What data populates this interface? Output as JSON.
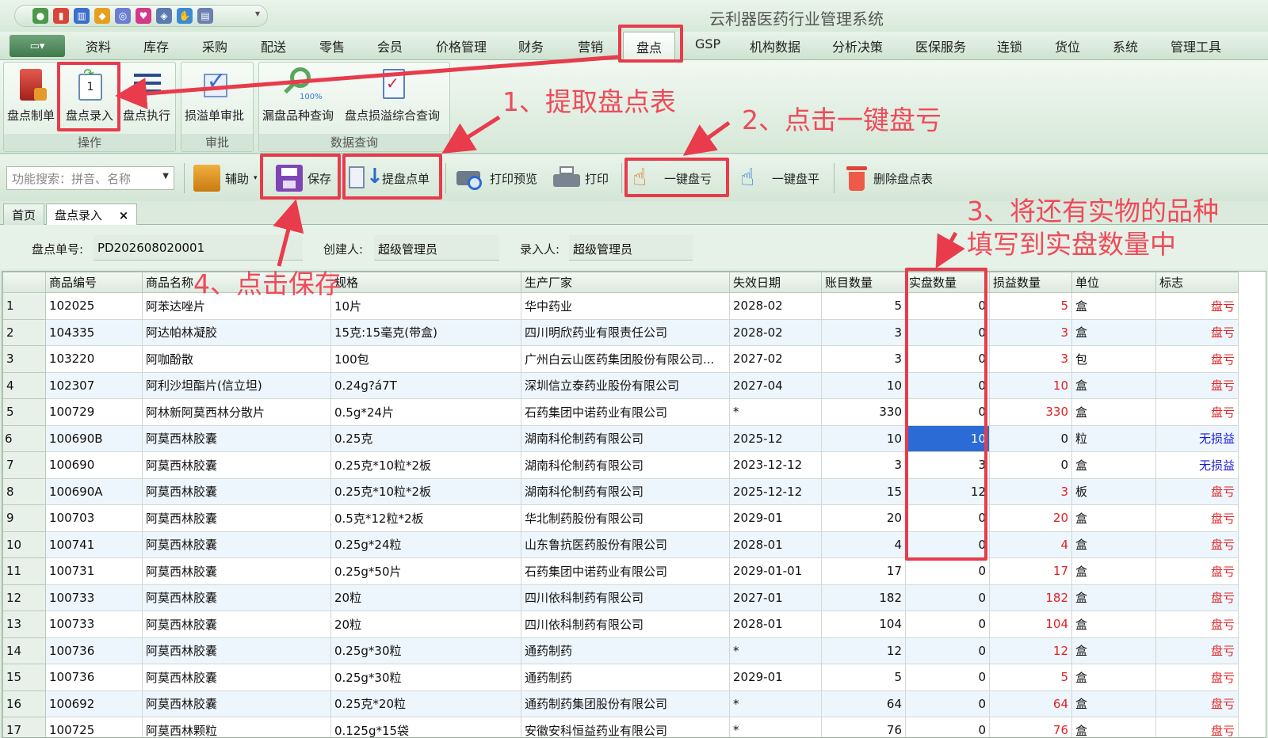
{
  "app_title": "云利器医药行业管理系统",
  "menu": [
    "资料",
    "库存",
    "采购",
    "配送",
    "零售",
    "会员",
    "价格管理",
    "财务",
    "营销",
    "盘点",
    "GSP",
    "机构数据",
    "分析决策",
    "医保服务",
    "连锁",
    "货位",
    "系统",
    "管理工具"
  ],
  "ribbon": {
    "groups": [
      {
        "label": "操作",
        "buttons": [
          "盘点制单",
          "盘点录入",
          "盘点执行"
        ]
      },
      {
        "label": "审批",
        "buttons": [
          "损溢单审批"
        ]
      },
      {
        "label": "数据查询",
        "buttons": [
          "漏盘品种查询",
          "盘点损溢综合查询"
        ]
      }
    ],
    "badge_100": "100%"
  },
  "toolbar": {
    "search_placeholder": "功能搜索：拼音、名称",
    "buttons": [
      "辅助",
      "保存",
      "提盘点单",
      "打印预览",
      "打印",
      "一键盘亏",
      "一键盘平",
      "删除盘点表"
    ]
  },
  "tabs": [
    "首页",
    "盘点录入"
  ],
  "tab_close": "×",
  "form": {
    "order_no_label": "盘点单号:",
    "order_no": "PD202608020001",
    "creator_label": "创建人:",
    "creator": "超级管理员",
    "entry_label": "录入人:",
    "entry": "超级管理员"
  },
  "columns": [
    "商品编号",
    "商品名称",
    "规格",
    "生产厂家",
    "失效日期",
    "账目数量",
    "实盘数量",
    "损益数量",
    "单位",
    "标志"
  ],
  "rows": [
    [
      "1",
      "102025",
      "阿苯达唑片",
      "10片",
      "华中药业",
      "2028-02",
      "5",
      "0",
      "5",
      "盒",
      "盘亏"
    ],
    [
      "2",
      "104335",
      "阿达帕林凝胶",
      "15克:15毫克(带盒)",
      "四川明欣药业有限责任公司",
      "2028-02",
      "3",
      "0",
      "3",
      "盒",
      "盘亏"
    ],
    [
      "3",
      "103220",
      "阿咖酚散",
      "100包",
      "广州白云山医药集团股份有限公司...",
      "2027-02",
      "3",
      "0",
      "3",
      "包",
      "盘亏"
    ],
    [
      "4",
      "102307",
      "阿利沙坦酯片(信立坦)",
      "0.24g?á7T",
      "深圳信立泰药业股份有限公司",
      "2027-04",
      "10",
      "0",
      "10",
      "盒",
      "盘亏"
    ],
    [
      "5",
      "100729",
      "阿林新阿莫西林分散片",
      "0.5g*24片",
      "石药集团中诺药业有限公司",
      "*",
      "330",
      "0",
      "330",
      "盒",
      "盘亏"
    ],
    [
      "6",
      "100690B",
      "阿莫西林胶囊",
      "0.25克",
      "湖南科伦制药有限公司",
      "2025-12",
      "10",
      "10",
      "0",
      "粒",
      "无损益"
    ],
    [
      "7",
      "100690",
      "阿莫西林胶囊",
      "0.25克*10粒*2板",
      "湖南科伦制药有限公司",
      "2023-12-12",
      "3",
      "3",
      "0",
      "盒",
      "无损益"
    ],
    [
      "8",
      "100690A",
      "阿莫西林胶囊",
      "0.25克*10粒*2板",
      "湖南科伦制药有限公司",
      "2025-12-12",
      "15",
      "12",
      "3",
      "板",
      "盘亏"
    ],
    [
      "9",
      "100703",
      "阿莫西林胶囊",
      "0.5克*12粒*2板",
      "华北制药股份有限公司",
      "2029-01",
      "20",
      "0",
      "20",
      "盒",
      "盘亏"
    ],
    [
      "10",
      "100741",
      "阿莫西林胶囊",
      "0.25g*24粒",
      "山东鲁抗医药股份有限公司",
      "2028-01",
      "4",
      "0",
      "4",
      "盒",
      "盘亏"
    ],
    [
      "11",
      "100731",
      "阿莫西林胶囊",
      "0.25g*50片",
      "石药集团中诺药业有限公司",
      "2029-01-01",
      "17",
      "0",
      "17",
      "盒",
      "盘亏"
    ],
    [
      "12",
      "100733",
      "阿莫西林胶囊",
      "20粒",
      "四川依科制药有限公司",
      "2027-01",
      "182",
      "0",
      "182",
      "盒",
      "盘亏"
    ],
    [
      "13",
      "100733",
      "阿莫西林胶囊",
      "20粒",
      "四川依科制药有限公司",
      "2028-01",
      "104",
      "0",
      "104",
      "盒",
      "盘亏"
    ],
    [
      "14",
      "100736",
      "阿莫西林胶囊",
      "0.25g*30粒",
      "通药制药",
      "*",
      "12",
      "0",
      "12",
      "盒",
      "盘亏"
    ],
    [
      "15",
      "100736",
      "阿莫西林胶囊",
      "0.25g*30粒",
      "通药制药",
      "2029-01",
      "5",
      "0",
      "5",
      "盒",
      "盘亏"
    ],
    [
      "16",
      "100692",
      "阿莫西林胶囊",
      "0.25克*20粒",
      "通药制药集团股份有限公司",
      "*",
      "64",
      "0",
      "64",
      "盒",
      "盘亏"
    ],
    [
      "17",
      "100725",
      "阿莫西林颗粒",
      "0.125g*15袋",
      "安徽安科恒益药业有限公司",
      "*",
      "76",
      "0",
      "76",
      "盒",
      "盘亏"
    ]
  ],
  "selected_row": "6",
  "annotations": {
    "step1": "1、提取盘点表",
    "step2": "2、点击一键盘亏",
    "step3_line1": "3、将还有实物的品种",
    "step3_line2": "填写到实盘数量中",
    "step4": "4、点击保存"
  },
  "colors": {
    "annotation": "#e83b4b",
    "loss_flag": "#e02020",
    "no_change_flag": "#1a1ad8",
    "selection": "#2b6bd6"
  }
}
